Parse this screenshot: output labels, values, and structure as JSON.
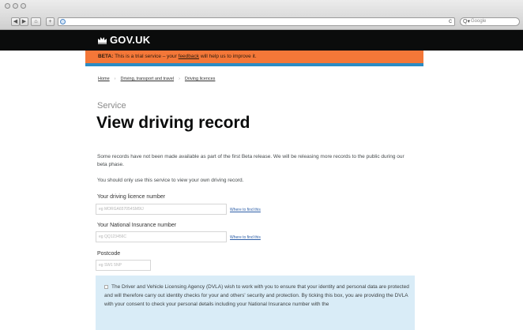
{
  "browser": {
    "search_placeholder": "Google",
    "nav_back": "◀",
    "nav_forward": "▶",
    "home": "⌂",
    "add": "+",
    "reload": "c"
  },
  "header": {
    "logo": "GOV.UK"
  },
  "beta": {
    "tag": "BETA:",
    "text_before": " This is a trial service – your ",
    "link": "feedback",
    "text_after": " will help us to improve it."
  },
  "breadcrumb": {
    "items": [
      "Home",
      "Driving, transport and travel",
      "Driving licences"
    ],
    "separator": "›"
  },
  "service_label": "Service",
  "title": "View driving record",
  "paragraphs": [
    "Some records have not been made available as part of the first Beta release. We will be releasing more records to the public during our beta phase.",
    "You should only use this service to view your own driving record."
  ],
  "form": {
    "licence": {
      "label": "Your driving licence number",
      "placeholder": "eg MORGA657054SM9IJ",
      "help": "Where to find this"
    },
    "ni": {
      "label": "Your National Insurance number",
      "placeholder": "eg QQ123456C",
      "help": "Where to find this"
    },
    "postcode": {
      "label": "Postcode",
      "placeholder": "eg SW1 5NP"
    }
  },
  "consent": {
    "text": "The Driver and Vehicle Licensing Agency (DVLA) wish to work with you to ensure that your identity and personal data are protected and will therefore carry out identity checks for your and others' security and protection. By ticking this box, you are providing the DVLA with your consent to check your personal details including your National Insurance number with the"
  },
  "colors": {
    "header_bg": "#0b0c0c",
    "beta_bg": "#f47738",
    "rule": "#2b8cc4",
    "consent_bg": "#d9ecf7",
    "link": "#2e5fa8"
  }
}
